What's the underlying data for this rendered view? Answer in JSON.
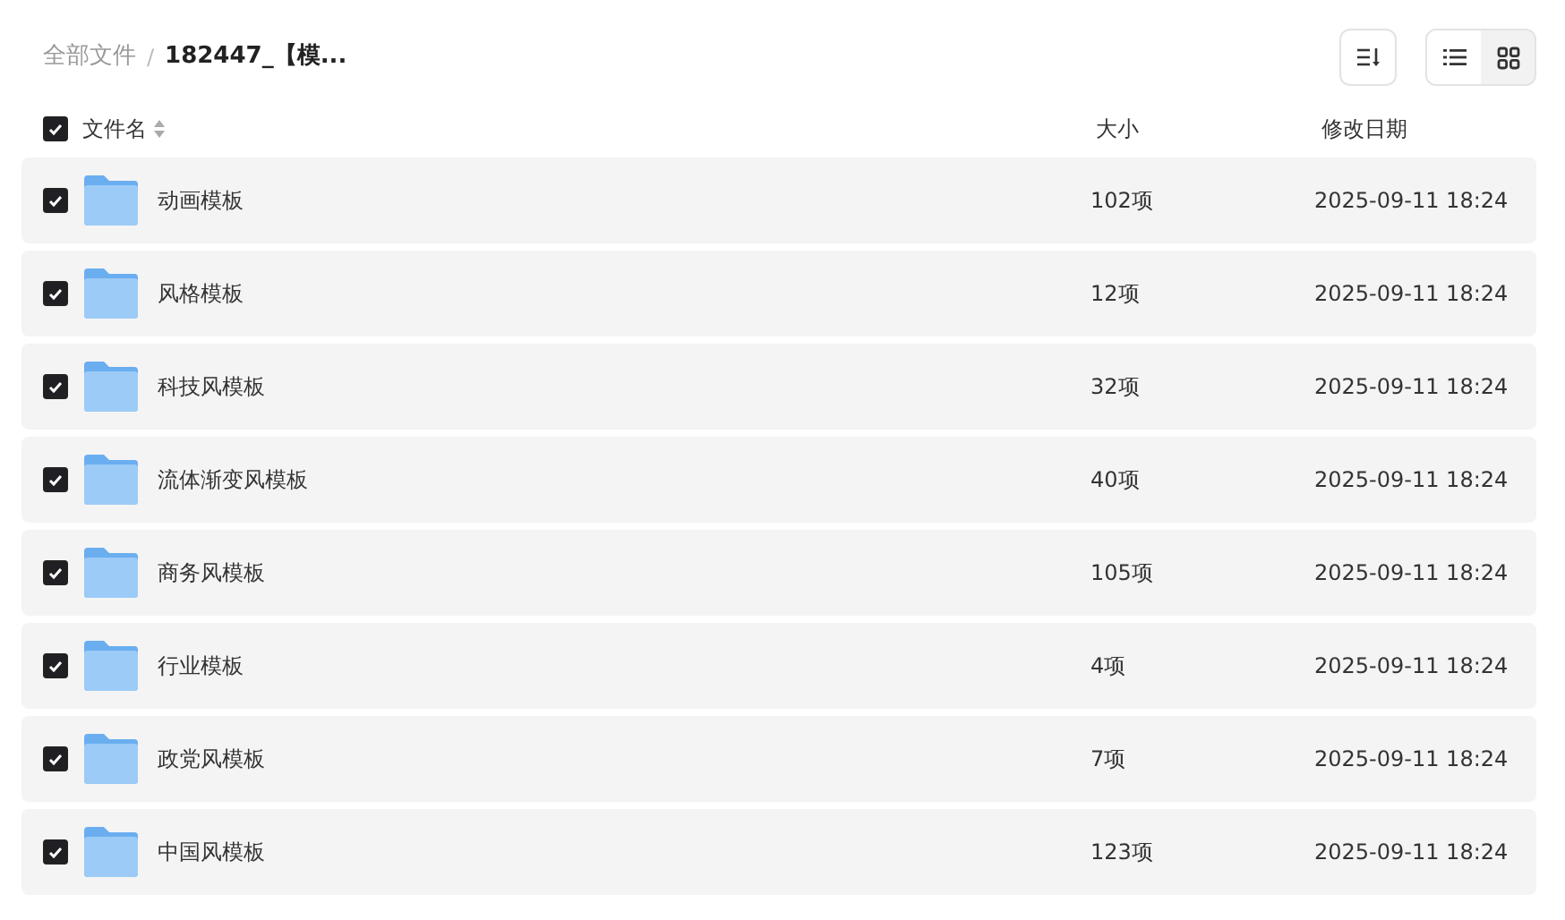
{
  "breadcrumb_separator": "/",
  "breadcrumb": [
    {
      "label": "全部文件",
      "current": false
    },
    {
      "label": "182447_【模...",
      "current": true
    }
  ],
  "view_toggle": [
    {
      "kind": "list",
      "selected": true
    },
    {
      "kind": "grid",
      "selected": false
    }
  ],
  "columns": {
    "select_all": {
      "checked": true
    },
    "name": "文件名",
    "size": "大小",
    "modified": "修改日期"
  },
  "rows": [
    {
      "name": "动画模板",
      "size": "102项",
      "modified": "2025-09-11 18:24",
      "checked": true
    },
    {
      "name": "风格模板",
      "size": "12项",
      "modified": "2025-09-11 18:24",
      "checked": true
    },
    {
      "name": "科技风模板",
      "size": "32项",
      "modified": "2025-09-11 18:24",
      "checked": true
    },
    {
      "name": "流体渐变风模板",
      "size": "40项",
      "modified": "2025-09-11 18:24",
      "checked": true
    },
    {
      "name": "商务风模板",
      "size": "105项",
      "modified": "2025-09-11 18:24",
      "checked": true
    },
    {
      "name": "行业模板",
      "size": "4项",
      "modified": "2025-09-11 18:24",
      "checked": true
    },
    {
      "name": "政党风模板",
      "size": "7项",
      "modified": "2025-09-11 18:24",
      "checked": true
    },
    {
      "name": "中国风模板",
      "size": "123项",
      "modified": "2025-09-11 18:24",
      "checked": true
    }
  ]
}
